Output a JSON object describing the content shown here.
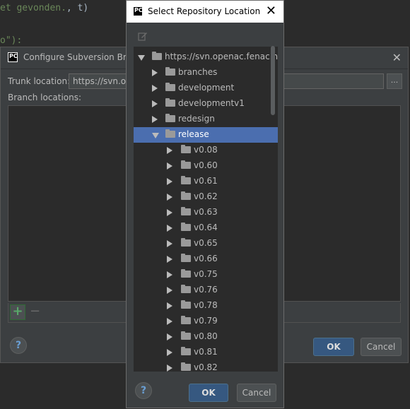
{
  "editor": {
    "line1_text": "et gevonden.",
    "line1_rest": ", t)",
    "line2_text": "o\"):"
  },
  "configure_dialog": {
    "title": "Configure Subversion Branc",
    "trunk_label": "Trunk location:",
    "trunk_value": "https://svn.ope",
    "browse_label": "...",
    "branch_locations_label": "Branch locations:",
    "add_label": "+",
    "remove_label": "−",
    "help_label": "?",
    "ok_label": "OK",
    "cancel_label": "Cancel"
  },
  "select_dialog": {
    "title": "Select Repository Location",
    "logo_text": "PC",
    "close_label": "✕",
    "tree": {
      "root": "https://svn.openac.fenac.nl",
      "children": [
        {
          "label": "branches"
        },
        {
          "label": "development"
        },
        {
          "label": "developmentv1"
        },
        {
          "label": "redesign"
        },
        {
          "label": "release"
        }
      ],
      "release_children": [
        {
          "label": "v0.08"
        },
        {
          "label": "v0.60"
        },
        {
          "label": "v0.61"
        },
        {
          "label": "v0.62"
        },
        {
          "label": "v0.63"
        },
        {
          "label": "v0.64"
        },
        {
          "label": "v0.65"
        },
        {
          "label": "v0.66"
        },
        {
          "label": "v0.75"
        },
        {
          "label": "v0.76"
        },
        {
          "label": "v0.78"
        },
        {
          "label": "v0.79"
        },
        {
          "label": "v0.80"
        },
        {
          "label": "v0.81"
        },
        {
          "label": "v0.82"
        }
      ],
      "selected": "release"
    },
    "help_label": "?",
    "ok_label": "OK",
    "cancel_label": "Cancel"
  },
  "colors": {
    "selection": "#4b6eaf",
    "dialog_bg": "#3c3f41",
    "editor_bg": "#2b2b2b",
    "primary_button": "#365880"
  }
}
